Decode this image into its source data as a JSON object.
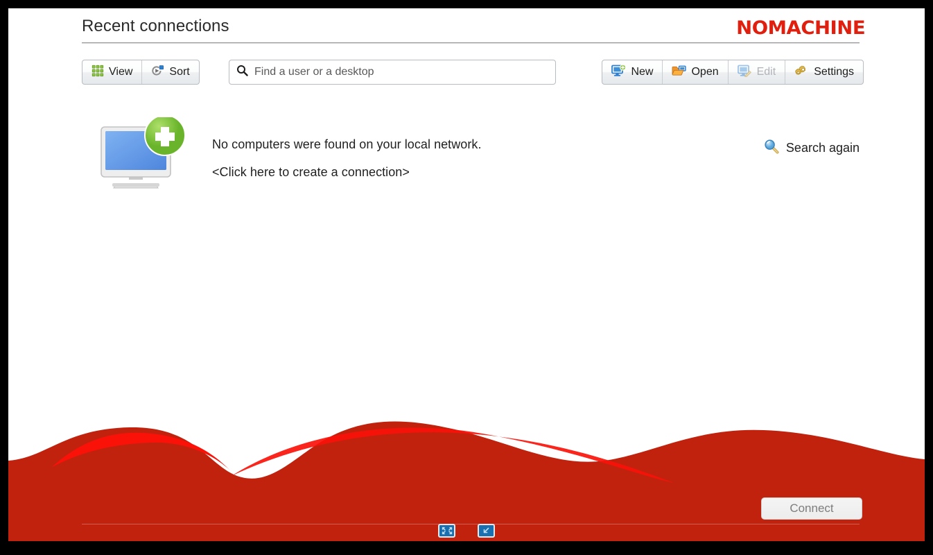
{
  "window": {
    "title": "Recent connections",
    "brand": "NOMACHINE"
  },
  "toolbar": {
    "left_buttons": [
      {
        "id": "view",
        "label": "View",
        "icon": "grid-icon",
        "disabled": false
      },
      {
        "id": "sort",
        "label": "Sort",
        "icon": "sort-icon",
        "disabled": false
      }
    ],
    "search": {
      "placeholder": "Find a user or a desktop",
      "value": "",
      "icon": "search-icon"
    },
    "right_buttons": [
      {
        "id": "new",
        "label": "New",
        "icon": "new-connection-icon",
        "disabled": false
      },
      {
        "id": "open",
        "label": "Open",
        "icon": "folder-open-icon",
        "disabled": false
      },
      {
        "id": "edit",
        "label": "Edit",
        "icon": "edit-icon",
        "disabled": true
      },
      {
        "id": "settings",
        "label": "Settings",
        "icon": "gears-icon",
        "disabled": false
      }
    ]
  },
  "content": {
    "empty_state_icon": "monitor-add-icon",
    "message": "No computers were found on your local network.",
    "create_link": "<Click here to create a connection>",
    "search_again": {
      "label": "Search again",
      "icon": "magnifier-icon"
    }
  },
  "footer": {
    "connect_label": "Connect",
    "connect_disabled": true,
    "window_controls": [
      {
        "id": "fullscreen",
        "icon": "fullscreen-icon"
      },
      {
        "id": "restore",
        "icon": "restore-window-icon"
      }
    ]
  },
  "colors": {
    "brand_red": "#e01f0f",
    "wave_red": "#c0220e",
    "wave_highlight": "#fa1209",
    "accent_blue": "#4a90d9",
    "accent_green": "#7ac943",
    "frame_black": "#000000"
  }
}
